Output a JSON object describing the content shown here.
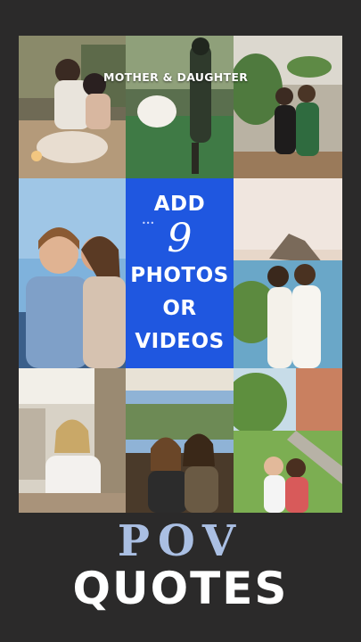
{
  "grid": {
    "label": "MOTHER & DAUGHTER",
    "center_panel": {
      "line1": "ADD",
      "number": "9",
      "line2": "PHOTOS",
      "line3": "OR",
      "line4": "VIDEOS",
      "bg_color": "#1f57e0"
    }
  },
  "footer": {
    "title_1": "POV",
    "title_2": "QUOTES"
  },
  "colors": {
    "background": "#2b2a2a",
    "pov_text": "#aabfe3",
    "quotes_text": "#ffffff"
  }
}
